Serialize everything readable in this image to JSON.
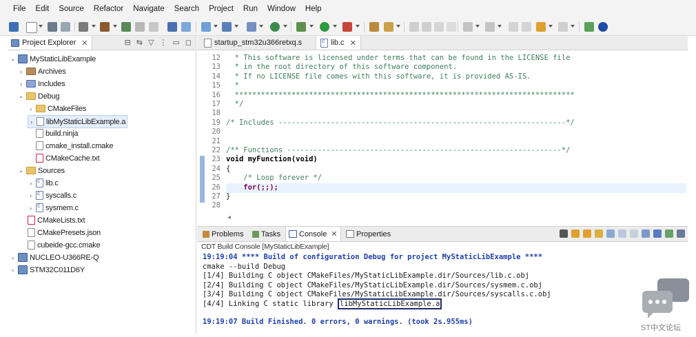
{
  "menu": [
    "File",
    "Edit",
    "Source",
    "Refactor",
    "Navigate",
    "Search",
    "Project",
    "Run",
    "Window",
    "Help"
  ],
  "project_explorer": {
    "tab_label": "Project Explorer",
    "nodes": [
      {
        "label": "MyStaticLibExample"
      },
      {
        "label": "Archives"
      },
      {
        "label": "Includes"
      },
      {
        "label": "Debug"
      },
      {
        "label": "CMakeFiles"
      },
      {
        "label": "libMyStaticLibExample.a"
      },
      {
        "label": "build.ninja"
      },
      {
        "label": "cmake_install.cmake"
      },
      {
        "label": "CMakeCache.txt"
      },
      {
        "label": "Sources"
      },
      {
        "label": "lib.c"
      },
      {
        "label": "syscalls.c"
      },
      {
        "label": "sysmem.c"
      },
      {
        "label": "CMakeLists.txt"
      },
      {
        "label": "CMakePresets.json"
      },
      {
        "label": "cubeide-gcc.cmake"
      },
      {
        "label": "NUCLEO-U366RE-Q"
      },
      {
        "label": "STM32C011D6Y"
      }
    ]
  },
  "editor": {
    "tabs": [
      {
        "label": "startup_stm32u366retxq.s"
      },
      {
        "label": "lib.c"
      }
    ],
    "line_numbers": [
      "12",
      "13",
      "14",
      "15",
      "16",
      "17",
      "18",
      "19",
      "20",
      "21",
      "22",
      "23",
      "24",
      "25",
      "26",
      "27",
      "28"
    ],
    "lines": [
      "  * This software is licensed under terms that can be found in the LICENSE file",
      "  * in the root directory of this software component.",
      "  * If no LICENSE file comes with this software, it is provided AS-IS.",
      "  *",
      "  ******************************************************************************",
      "  */",
      "",
      "/* Includes ------------------------------------------------------------------*/",
      "",
      "",
      "/** Functions ---------------------------------------------------------------*/",
      "void myFunction(void)",
      "{",
      "    /* Loop forever */",
      "    for(;;);",
      "}",
      ""
    ]
  },
  "console": {
    "tabs": [
      "Problems",
      "Tasks",
      "Console",
      "Properties"
    ],
    "title": "CDT Build Console [MyStaticLibExample]",
    "lines": [
      "19:19:04 **** Build of configuration Debug for project MyStaticLibExample ****",
      "cmake --build Debug",
      "[1/4] Building C object CMakeFiles/MyStaticLibExample.dir/Sources/lib.c.obj",
      "[2/4] Building C object CMakeFiles/MyStaticLibExample.dir/Sources/sysmem.c.obj",
      "[3/4] Building C object CMakeFiles/MyStaticLibExample.dir/Sources/syscalls.c.obj"
    ],
    "link_prefix": "[4/4] Linking C static library ",
    "link_target": "libMyStaticLibExample.a",
    "finished": "19:19:07 Build Finished. 0 errors, 0 warnings. (took 2s.955ms)"
  },
  "watermark": {
    "text": "ST中文论坛"
  },
  "colors": {
    "comment": "#3f7f5f",
    "keyword": "#7f0055",
    "console_blue": "#1f3fa8",
    "selection": "#e5eefb"
  }
}
